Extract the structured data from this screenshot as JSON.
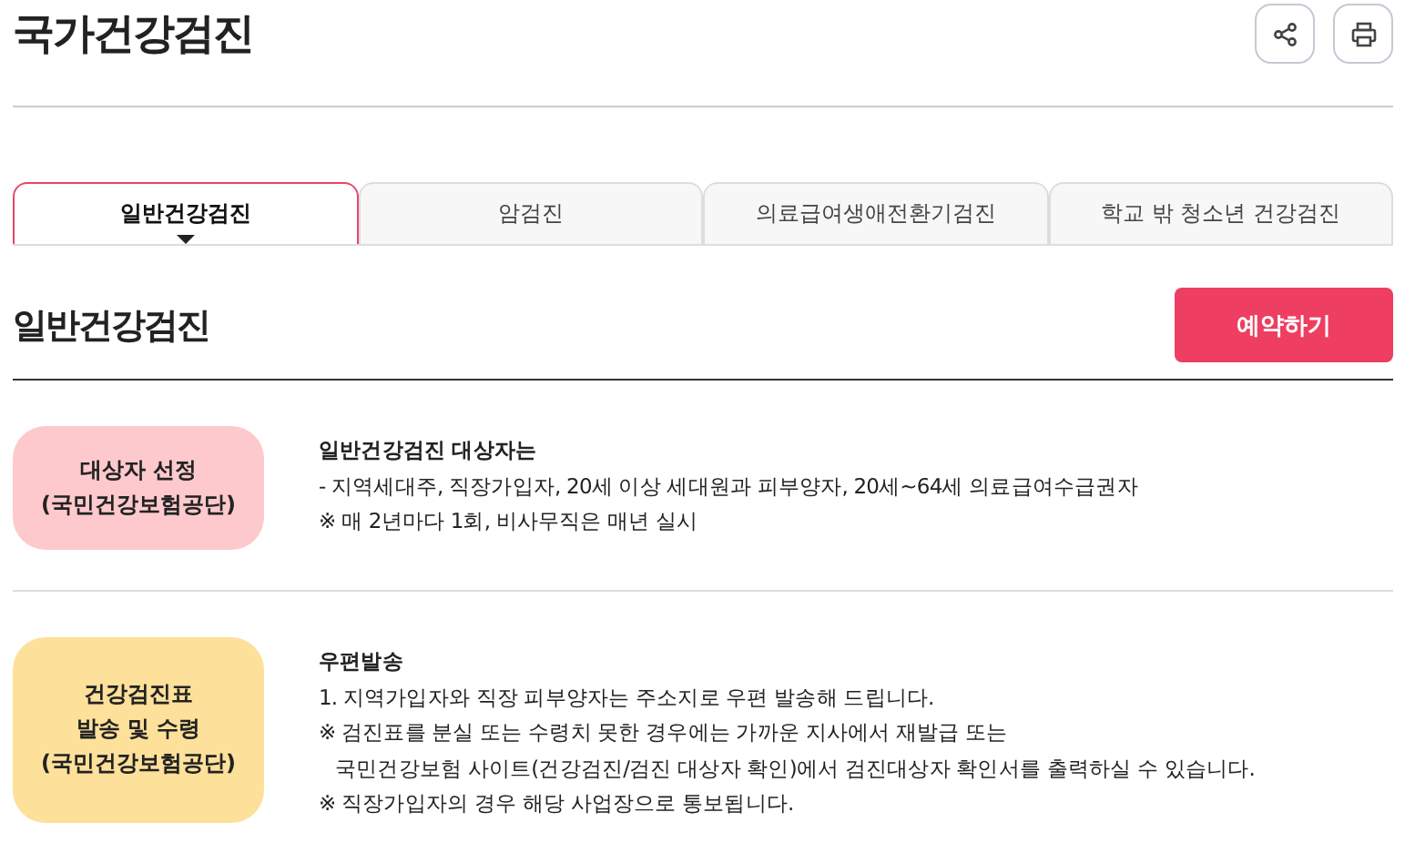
{
  "page_title": "국가건강검진",
  "tabs": [
    {
      "label": "일반건강검진",
      "selected": true
    },
    {
      "label": "암검진",
      "selected": false
    },
    {
      "label": "의료급여생애전환기검진",
      "selected": false
    },
    {
      "label": "학교 밖 청소년 건강검진",
      "selected": false
    }
  ],
  "section": {
    "title": "일반건강검진",
    "button": "예약하기"
  },
  "steps": [
    {
      "label": [
        "대상자 선정",
        "(국민건강보험공단)"
      ],
      "color": "#fec9cc",
      "lines": [
        {
          "kind": "heading",
          "text": "일반건강검진 대상자는"
        },
        {
          "kind": "text",
          "text": "- 지역세대주, 직장가입자, 20세 이상 세대원과 피부양자, 20세~64세 의료급여수급권자"
        },
        {
          "kind": "text",
          "text": "※ 매 2년마다 1회, 비사무직은 매년 실시"
        }
      ]
    },
    {
      "label": [
        "건강검진표",
        "발송 및 수령",
        "(국민건강보험공단)"
      ],
      "color": "#fde09a",
      "lines": [
        {
          "kind": "heading",
          "text": "우편발송"
        },
        {
          "kind": "text",
          "text": "1. 지역가입자와 직장 피부양자는 주소지로 우편 발송해 드립니다."
        },
        {
          "kind": "text",
          "text": "※ 검진표를 분실 또는 수령치 못한 경우에는 가까운 지사에서 재발급 또는"
        },
        {
          "kind": "indent",
          "text": "국민건강보험 사이트(건강검진/검진 대상자 확인)에서 검진대상자 확인서를 출력하실 수 있습니다."
        },
        {
          "kind": "text",
          "text": "※ 직장가입자의 경우 해당 사업장으로 통보됩니다."
        }
      ]
    }
  ]
}
